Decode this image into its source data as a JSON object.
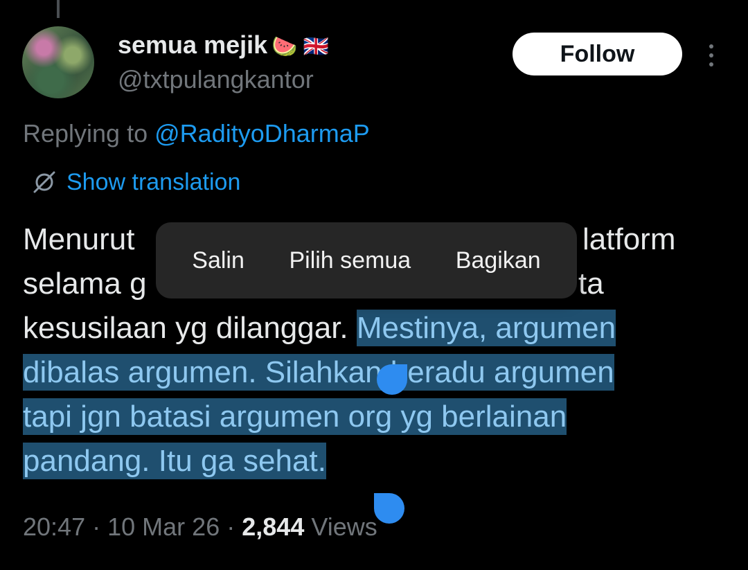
{
  "author": {
    "name": "semua mejik",
    "emojis": "🍉 🇬🇧",
    "handle": "@txtpulangkantor"
  },
  "follow_label": "Follow",
  "reply_to": {
    "prefix": "Replying to",
    "mention": "@RadityoDharmaP"
  },
  "translate_label": "Show translation",
  "tweet": {
    "line1_a": "Menurut",
    "line1_b": "latform",
    "line2_a": "selama g",
    "line2_b": "ta",
    "line3_plain": "kesusilaan yg dilanggar. ",
    "line3_sel": "Mestinya, argumen",
    "line4_sel": "dibalas argumen. Silahkan beradu argumen",
    "line5_sel": "tapi jgn batasi argumen org yg berlainan",
    "line6_sel": "pandang. Itu ga sehat."
  },
  "context_menu": {
    "copy": "Salin",
    "select_all": "Pilih semua",
    "share": "Bagikan"
  },
  "meta": {
    "time": "20:47",
    "date": "10 Mar 26",
    "views_count": "2,844",
    "views_label": "Views"
  }
}
